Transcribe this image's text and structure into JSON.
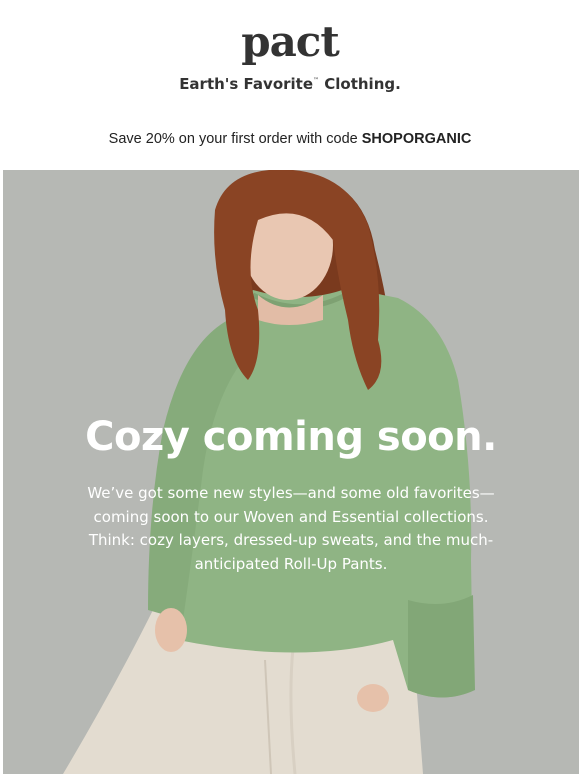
{
  "header": {
    "logo": "pact",
    "tagline_prefix": "Earth's Favorite",
    "tagline_tm": "™",
    "tagline_suffix": "Clothing."
  },
  "promo": {
    "text": "Save 20% on your first order with code ",
    "code": "SHOPORGANIC"
  },
  "hero": {
    "headline": "Cozy coming soon.",
    "body": "We’ve got some new styles—and some old favorites—coming soon to our Woven and Essential collections. Think: cozy layers, dressed-up sweats, and the much-anticipated Roll-Up Pants.",
    "colors": {
      "background": "#b6b8b4",
      "sweater": "#8fb484",
      "hair": "#8a4424",
      "pants": "#e3dcd0"
    }
  }
}
